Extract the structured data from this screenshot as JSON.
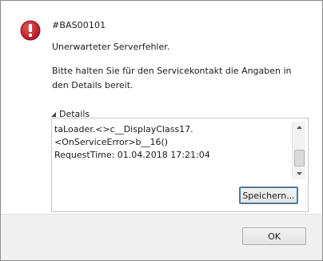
{
  "dialog": {
    "code": "#BAS00101",
    "headline": "Unerwarteter Serverfehler.",
    "hint": "Bitte halten Sie für den Servicekontakt die Angaben in den Details bereit.",
    "details_label": "Details",
    "details_text": "taLoader.<>c__DisplayClass17.<OnServiceError>b__16()\nRequestTime: 01.04.2018 17:21:04",
    "save_label": "Speichern...",
    "ok_label": "OK"
  },
  "icons": {
    "error": "error-icon",
    "expander": "triangle-expander-icon",
    "scroll_up": "chevron-up-icon",
    "scroll_down": "chevron-down-icon"
  },
  "colors": {
    "error_red": "#c9252c"
  }
}
